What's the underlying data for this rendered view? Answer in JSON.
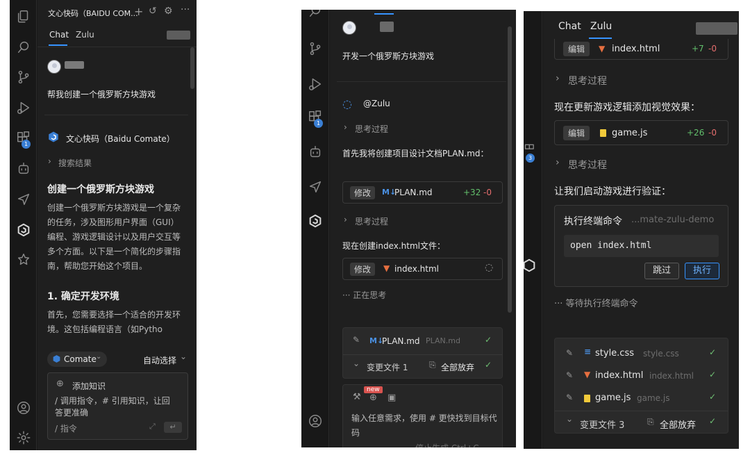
{
  "panel1": {
    "header_title": "文心快码（BAIDU COM...",
    "tabs": [
      "Chat",
      "Zulu"
    ],
    "user_message": "帮我创建一个俄罗斯方块游戏",
    "assistant_name": "文心快码（Baidu Comate）",
    "search_results_label": "搜索结果",
    "heading": "创建一个俄罗斯方块游戏",
    "intro": "创建一个俄罗斯方块游戏是一个复杂的任务，涉及图形用户界面（GUI）编程、游戏逻辑设计以及用户交互等多个方面。以下是一个简化的步骤指南，帮助您开始这个项目。",
    "section1_heading": "1. 确定开发环境",
    "section1_text": "首先，您需要选择一个适合的开发环境。这包括编程语言（如Pytho",
    "model_button": "Comate",
    "auto_select": "自动选择",
    "add_knowledge": "添加知识",
    "input_placeholder": "/ 调用指令，# 引用知识，让回答更准确",
    "command_hint": "/ 指令",
    "activity_badge": "1"
  },
  "panel2": {
    "user_message": "开发一个俄罗斯方块游戏",
    "agent_name": "@Zulu",
    "thinking_label": "思考过程",
    "step1_text": "首先我将创建项目设计文档PLAN.md：",
    "edit_label": "修改",
    "file1": {
      "name": "PLAN.md",
      "added": "+32",
      "removed": "-0"
    },
    "step2_text": "现在创建index.html文件：",
    "file2": {
      "name": "index.html"
    },
    "status_thinking": "··· 正在思考",
    "tray": {
      "file_name": "PLAN.md",
      "file_path": "PLAN.md",
      "changed_label": "变更文件 1",
      "discard_all": "全部放弃"
    },
    "new_tag": "new",
    "input_placeholder": "输入任意需求，使用 # 更快找到目标代码",
    "stop_label": "停止生成 Ctrl+C",
    "activity_badge": "1"
  },
  "panel3": {
    "tabs": [
      "Chat",
      "Zulu"
    ],
    "edit_label": "编辑",
    "file_top": {
      "name": "index.html",
      "added": "+7",
      "removed": "-0"
    },
    "thinking_label": "思考过程",
    "update_text": "现在更新游戏逻辑添加视觉效果：",
    "file_js": {
      "name": "game.js",
      "added": "+26",
      "removed": "-0"
    },
    "launch_text": "让我们启动游戏进行验证：",
    "terminal": {
      "title": "执行终端命令",
      "path": "...mate-zulu-demo",
      "command": "open index.html",
      "skip": "跳过",
      "run": "执行"
    },
    "status_waiting": "··· 等待执行终端命令",
    "tray": {
      "files": [
        {
          "name": "style.css",
          "path": "style.css"
        },
        {
          "name": "index.html",
          "path": "index.html"
        },
        {
          "name": "game.js",
          "path": "game.js"
        }
      ],
      "changed_label": "变更文件 3",
      "discard_all": "全部放弃"
    },
    "activity_badge": "3"
  }
}
